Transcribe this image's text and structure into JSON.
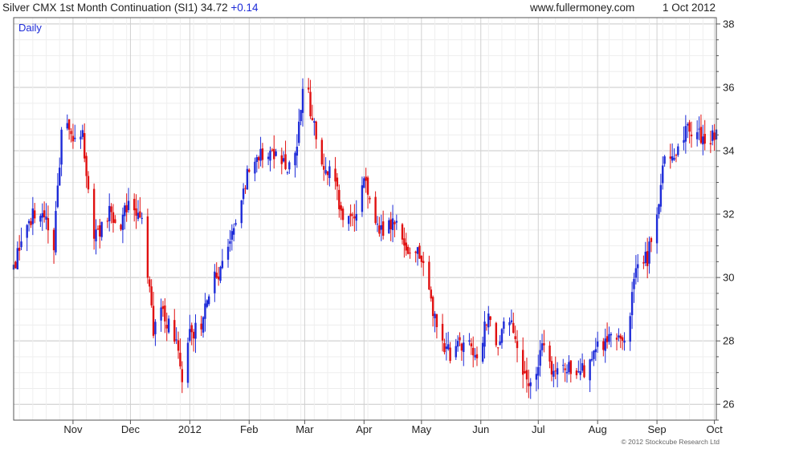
{
  "header": {
    "title": "Silver CMX 1st Month Continuation (SI1) 34.72",
    "change": "+0.14",
    "site": "www.fullermoney.com",
    "date": "1 Oct 2012"
  },
  "footer": {
    "copyright": "© 2012 Stockcube Research Ltd"
  },
  "colors": {
    "up": "#1d2bd8",
    "down": "#e01010",
    "grid": "#d4d4d4"
  },
  "chart_data": {
    "type": "candlestick",
    "period_label": "Daily",
    "x_tick_labels": [
      "Nov",
      "Dec",
      "2012",
      "Feb",
      "Mar",
      "Apr",
      "May",
      "Jun",
      "Jul",
      "Aug",
      "Sep",
      "Oct"
    ],
    "y_tick_labels": [
      "26",
      "28",
      "30",
      "32",
      "34",
      "36",
      "38"
    ],
    "ylim": [
      25.5,
      38.2
    ],
    "grid": true,
    "y_axis_side": "right",
    "x_range_days": [
      0,
      367
    ],
    "month_tick_days": [
      31,
      61,
      92,
      123,
      152,
      183,
      213,
      244,
      274,
      305,
      336,
      366
    ],
    "series": [
      {
        "key_points": [
          [
            0,
            30.3
          ],
          [
            5,
            31.6
          ],
          [
            12,
            32.1
          ],
          [
            17,
            31.9
          ],
          [
            20,
            30.2
          ],
          [
            24,
            33.6
          ],
          [
            26,
            35.3
          ],
          [
            31,
            34.2
          ],
          [
            36,
            34.4
          ],
          [
            42,
            31.3
          ],
          [
            50,
            32.0
          ],
          [
            55,
            31.6
          ],
          [
            61,
            32.6
          ],
          [
            68,
            31.5
          ],
          [
            73,
            28.4
          ],
          [
            78,
            29.0
          ],
          [
            85,
            27.8
          ],
          [
            88,
            26.8
          ],
          [
            92,
            28.3
          ],
          [
            97,
            28.4
          ],
          [
            104,
            29.9
          ],
          [
            110,
            30.5
          ],
          [
            118,
            32.0
          ],
          [
            123,
            33.6
          ],
          [
            128,
            33.9
          ],
          [
            136,
            33.8
          ],
          [
            143,
            33.4
          ],
          [
            148,
            34.2
          ],
          [
            152,
            36.6
          ],
          [
            155,
            35.3
          ],
          [
            160,
            33.9
          ],
          [
            167,
            33.1
          ],
          [
            172,
            31.9
          ],
          [
            178,
            31.9
          ],
          [
            183,
            33.2
          ],
          [
            190,
            31.5
          ],
          [
            195,
            31.5
          ],
          [
            200,
            31.7
          ],
          [
            206,
            30.7
          ],
          [
            211,
            30.9
          ],
          [
            214,
            30.3
          ],
          [
            220,
            28.6
          ],
          [
            228,
            27.5
          ],
          [
            236,
            28.0
          ],
          [
            242,
            27.5
          ],
          [
            248,
            28.8
          ],
          [
            252,
            27.8
          ],
          [
            258,
            28.7
          ],
          [
            264,
            27.8
          ],
          [
            268,
            26.6
          ],
          [
            272,
            26.5
          ],
          [
            276,
            27.9
          ],
          [
            282,
            26.9
          ],
          [
            290,
            27.2
          ],
          [
            298,
            27.1
          ],
          [
            306,
            27.9
          ],
          [
            312,
            28.1
          ],
          [
            318,
            28.0
          ],
          [
            322,
            29.0
          ],
          [
            327,
            30.8
          ],
          [
            331,
            30.6
          ],
          [
            336,
            32.2
          ],
          [
            340,
            33.7
          ],
          [
            344,
            33.9
          ],
          [
            350,
            34.6
          ],
          [
            356,
            34.7
          ],
          [
            362,
            34.0
          ],
          [
            367,
            34.72
          ]
        ]
      }
    ]
  }
}
